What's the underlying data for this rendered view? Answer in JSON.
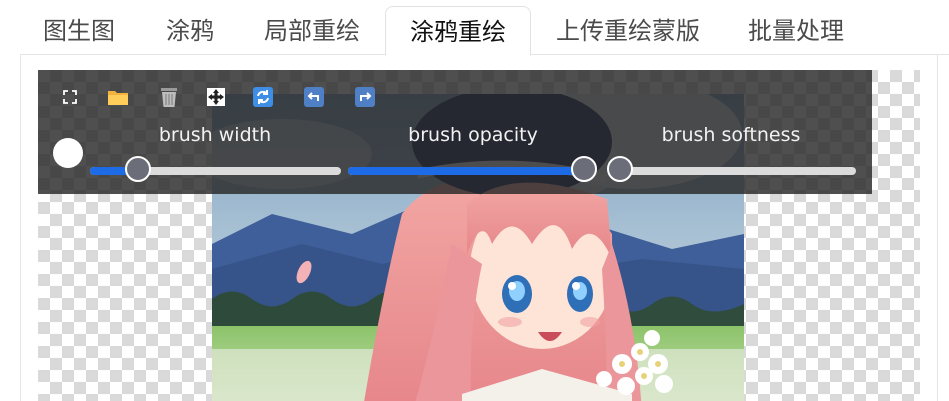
{
  "tabs": [
    {
      "label": "图生图",
      "active": false
    },
    {
      "label": "涂鸦",
      "active": false
    },
    {
      "label": "局部重绘",
      "active": false
    },
    {
      "label": "涂鸦重绘",
      "active": true
    },
    {
      "label": "上传重绘蒙版",
      "active": false
    },
    {
      "label": "批量处理",
      "active": false
    }
  ],
  "toolbar": {
    "icons": [
      "fullscreen-icon",
      "folder-icon",
      "trash-icon",
      "move-icon",
      "reset-icon",
      "undo-icon",
      "redo-icon"
    ],
    "brush_color": "#ffffff"
  },
  "sliders": [
    {
      "label": "brush width",
      "value": 0.19
    },
    {
      "label": "brush opacity",
      "value": 1.0
    },
    {
      "label": "brush softness",
      "value": 0.0
    }
  ],
  "colors": {
    "accent": "#1d6be6",
    "toolbar_bg": "#282828",
    "tab_border": "#e2e2e2"
  }
}
